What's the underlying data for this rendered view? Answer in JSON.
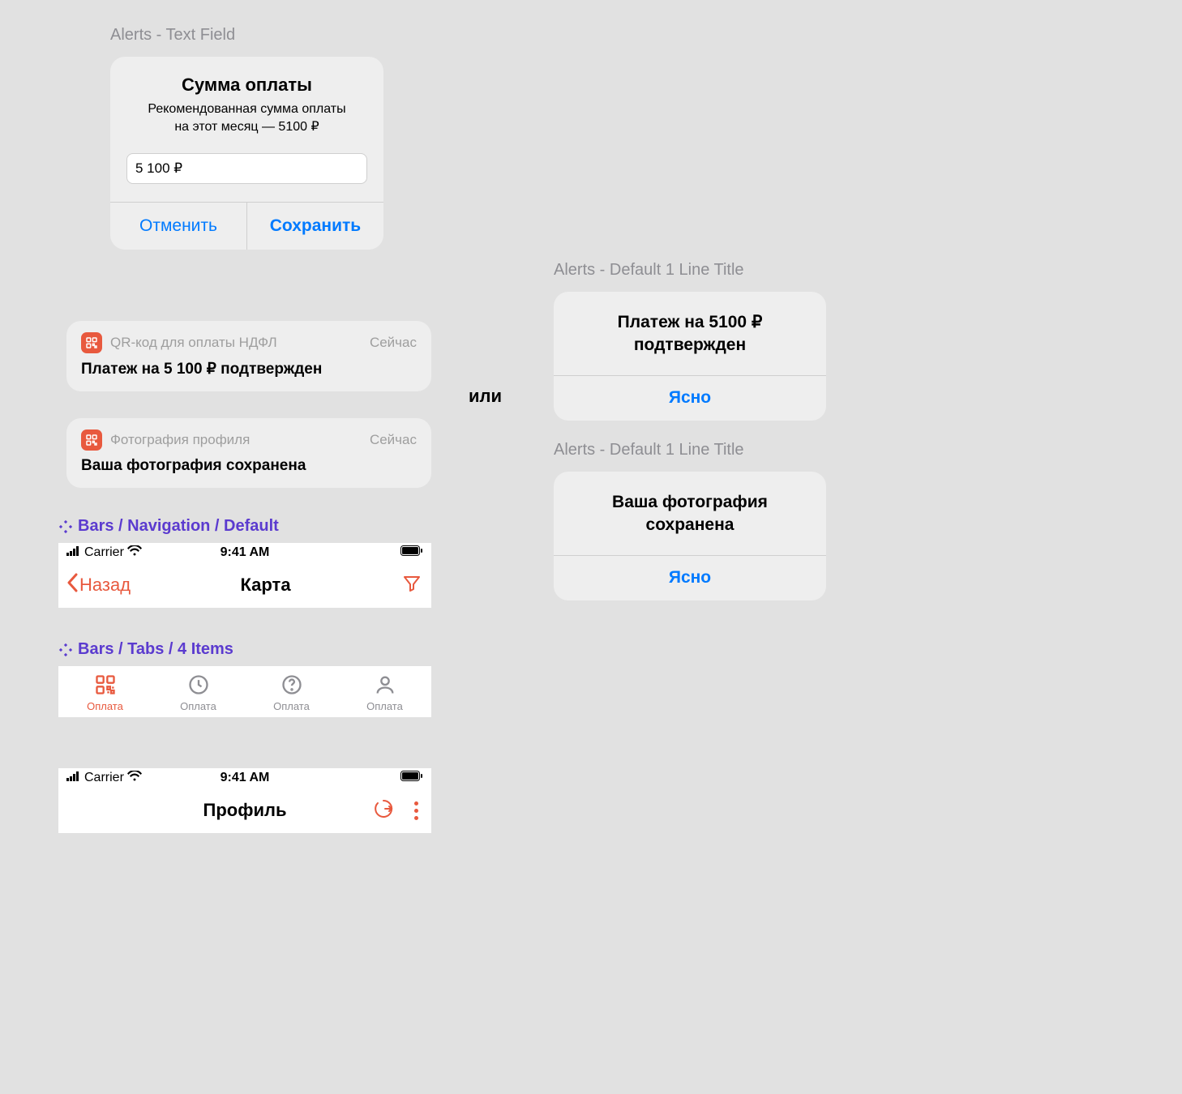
{
  "sections": {
    "alert_textfield_label": "Alerts - Text Field",
    "alert_default_label": "Alerts - Default 1 Line Title",
    "nav_label": "Bars / Navigation / Default",
    "tabs_label": "Bars / Tabs / 4 Items"
  },
  "alert": {
    "title": "Сумма оплаты",
    "subtitle_line1": "Рекомендованная сумма оплаты",
    "subtitle_line2": "на этот месяц — 5100 ₽",
    "input_value": "5 100 ₽",
    "cancel": "Отменить",
    "save": "Сохранить"
  },
  "notifications": [
    {
      "app": "QR-код для оплаты НДФЛ",
      "time": "Сейчас",
      "body": "Платеж на 5 100 ₽ подтвержден"
    },
    {
      "app": "Фотография профиля",
      "time": "Сейчас",
      "body": "Ваша фотография сохранена"
    }
  ],
  "connector": "или",
  "simple_alerts": [
    {
      "title_line1": "Платеж на 5100 ₽",
      "title_line2": "подтвержден",
      "action": "Ясно"
    },
    {
      "title_line1": "Ваша фотография",
      "title_line2": "сохранена",
      "action": "Ясно"
    }
  ],
  "status": {
    "carrier": "Carrier",
    "time": "9:41 AM"
  },
  "nav": {
    "back": "Назад",
    "title": "Карта"
  },
  "tabs": [
    {
      "label": "Оплата"
    },
    {
      "label": "Оплата"
    },
    {
      "label": "Оплата"
    },
    {
      "label": "Оплата"
    }
  ],
  "profile": {
    "title": "Профиль"
  }
}
